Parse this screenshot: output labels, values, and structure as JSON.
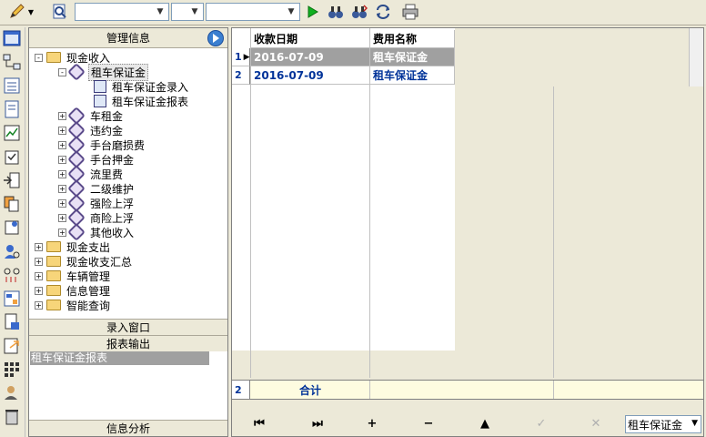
{
  "toolbar": {
    "combo1_value": "",
    "combo2_value": "",
    "combo3_value": ""
  },
  "nav": {
    "header": "管理信息",
    "tree": [
      {
        "label": "现金收入",
        "level": 0,
        "expander": "−",
        "icon": "folder"
      },
      {
        "label": "租车保证金",
        "level": 1,
        "expander": "−",
        "icon": "tag"
      },
      {
        "label": "租车保证金录入",
        "level": 2,
        "expander": "",
        "icon": "doc"
      },
      {
        "label": "租车保证金报表",
        "level": 2,
        "expander": "",
        "icon": "doc"
      },
      {
        "label": "车租金",
        "level": 1,
        "expander": "+",
        "icon": "tag"
      },
      {
        "label": "违约金",
        "level": 1,
        "expander": "+",
        "icon": "tag"
      },
      {
        "label": "手台磨损费",
        "level": 1,
        "expander": "+",
        "icon": "tag"
      },
      {
        "label": "手台押金",
        "level": 1,
        "expander": "+",
        "icon": "tag"
      },
      {
        "label": "流里费",
        "level": 1,
        "expander": "+",
        "icon": "tag"
      },
      {
        "label": "二级维护",
        "level": 1,
        "expander": "+",
        "icon": "tag"
      },
      {
        "label": "强险上浮",
        "level": 1,
        "expander": "+",
        "icon": "tag"
      },
      {
        "label": "商险上浮",
        "level": 1,
        "expander": "+",
        "icon": "tag"
      },
      {
        "label": "其他收入",
        "level": 1,
        "expander": "+",
        "icon": "tag"
      },
      {
        "label": "现金支出",
        "level": 0,
        "expander": "+",
        "icon": "folder"
      },
      {
        "label": "现金收支汇总",
        "level": 0,
        "expander": "+",
        "icon": "folder"
      },
      {
        "label": "车辆管理",
        "level": 0,
        "expander": "+",
        "icon": "folder"
      },
      {
        "label": "信息管理",
        "level": 0,
        "expander": "+",
        "icon": "folder"
      },
      {
        "label": "智能查询",
        "level": 0,
        "expander": "+",
        "icon": "folder"
      }
    ],
    "section_entry": "录入窗口",
    "section_report": "报表输出",
    "report_item": "租车保证金报表",
    "section_analysis": "信息分析"
  },
  "grid": {
    "columns": [
      "收款日期",
      "费用名称"
    ],
    "rows": [
      {
        "num": "1",
        "date": "2016-07-09",
        "name": "租车保证金"
      },
      {
        "num": "2",
        "date": "2016-07-09",
        "name": "租车保证金"
      }
    ],
    "footer_num": "2",
    "footer_label": "合计",
    "select_value": "租车保证金"
  }
}
